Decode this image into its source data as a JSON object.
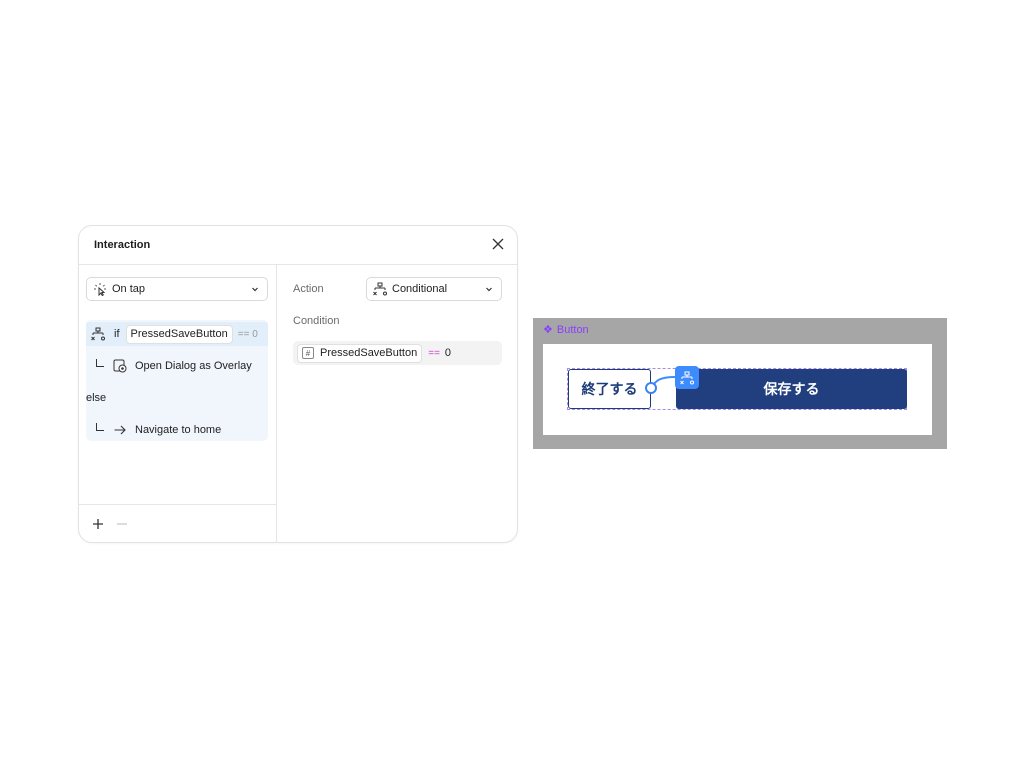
{
  "interaction_panel": {
    "title": "Interaction",
    "trigger": {
      "label": "On tap",
      "icon": "tap-icon"
    },
    "flow": {
      "if_keyword": "if",
      "if_variable": "PressedSaveButton",
      "if_operator": "== 0",
      "then_action": "Open Dialog as Overlay",
      "else_keyword": "else",
      "else_action": "Navigate to home"
    },
    "action_label": "Action",
    "action_value": "Conditional",
    "condition_label": "Condition",
    "condition": {
      "variable": "PressedSaveButton",
      "operator": "==",
      "value": "0"
    }
  },
  "canvas": {
    "component_label": "Button",
    "end_button_label": "終了する",
    "save_button_label": "保存する",
    "colors": {
      "accent": "#3d8bfd",
      "component": "#8a3ffc",
      "button_navy": "#213f7e",
      "canvas_bg": "#a6a6a6"
    }
  }
}
